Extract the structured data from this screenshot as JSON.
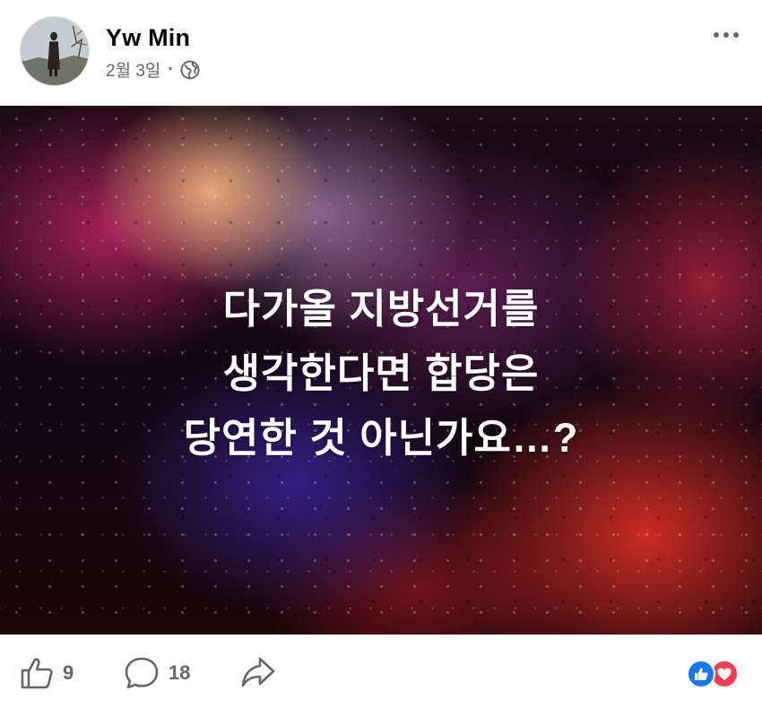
{
  "post": {
    "author": "Yw Min",
    "date": "2월 3일",
    "separator": "·",
    "privacy_icon": "globe-icon",
    "image_text": {
      "line1": "다가올 지방선거를",
      "line2": "생각한다면 합당은",
      "line3": "당연한 것 아닌가요…?"
    }
  },
  "footer": {
    "like_count": "9",
    "comment_count": "18",
    "reactions": [
      "like-reaction-icon",
      "love-reaction-icon"
    ]
  },
  "colors": {
    "meta_gray": "#65676b",
    "like_blue": "#1877f2",
    "love_red": "#f33e58"
  }
}
